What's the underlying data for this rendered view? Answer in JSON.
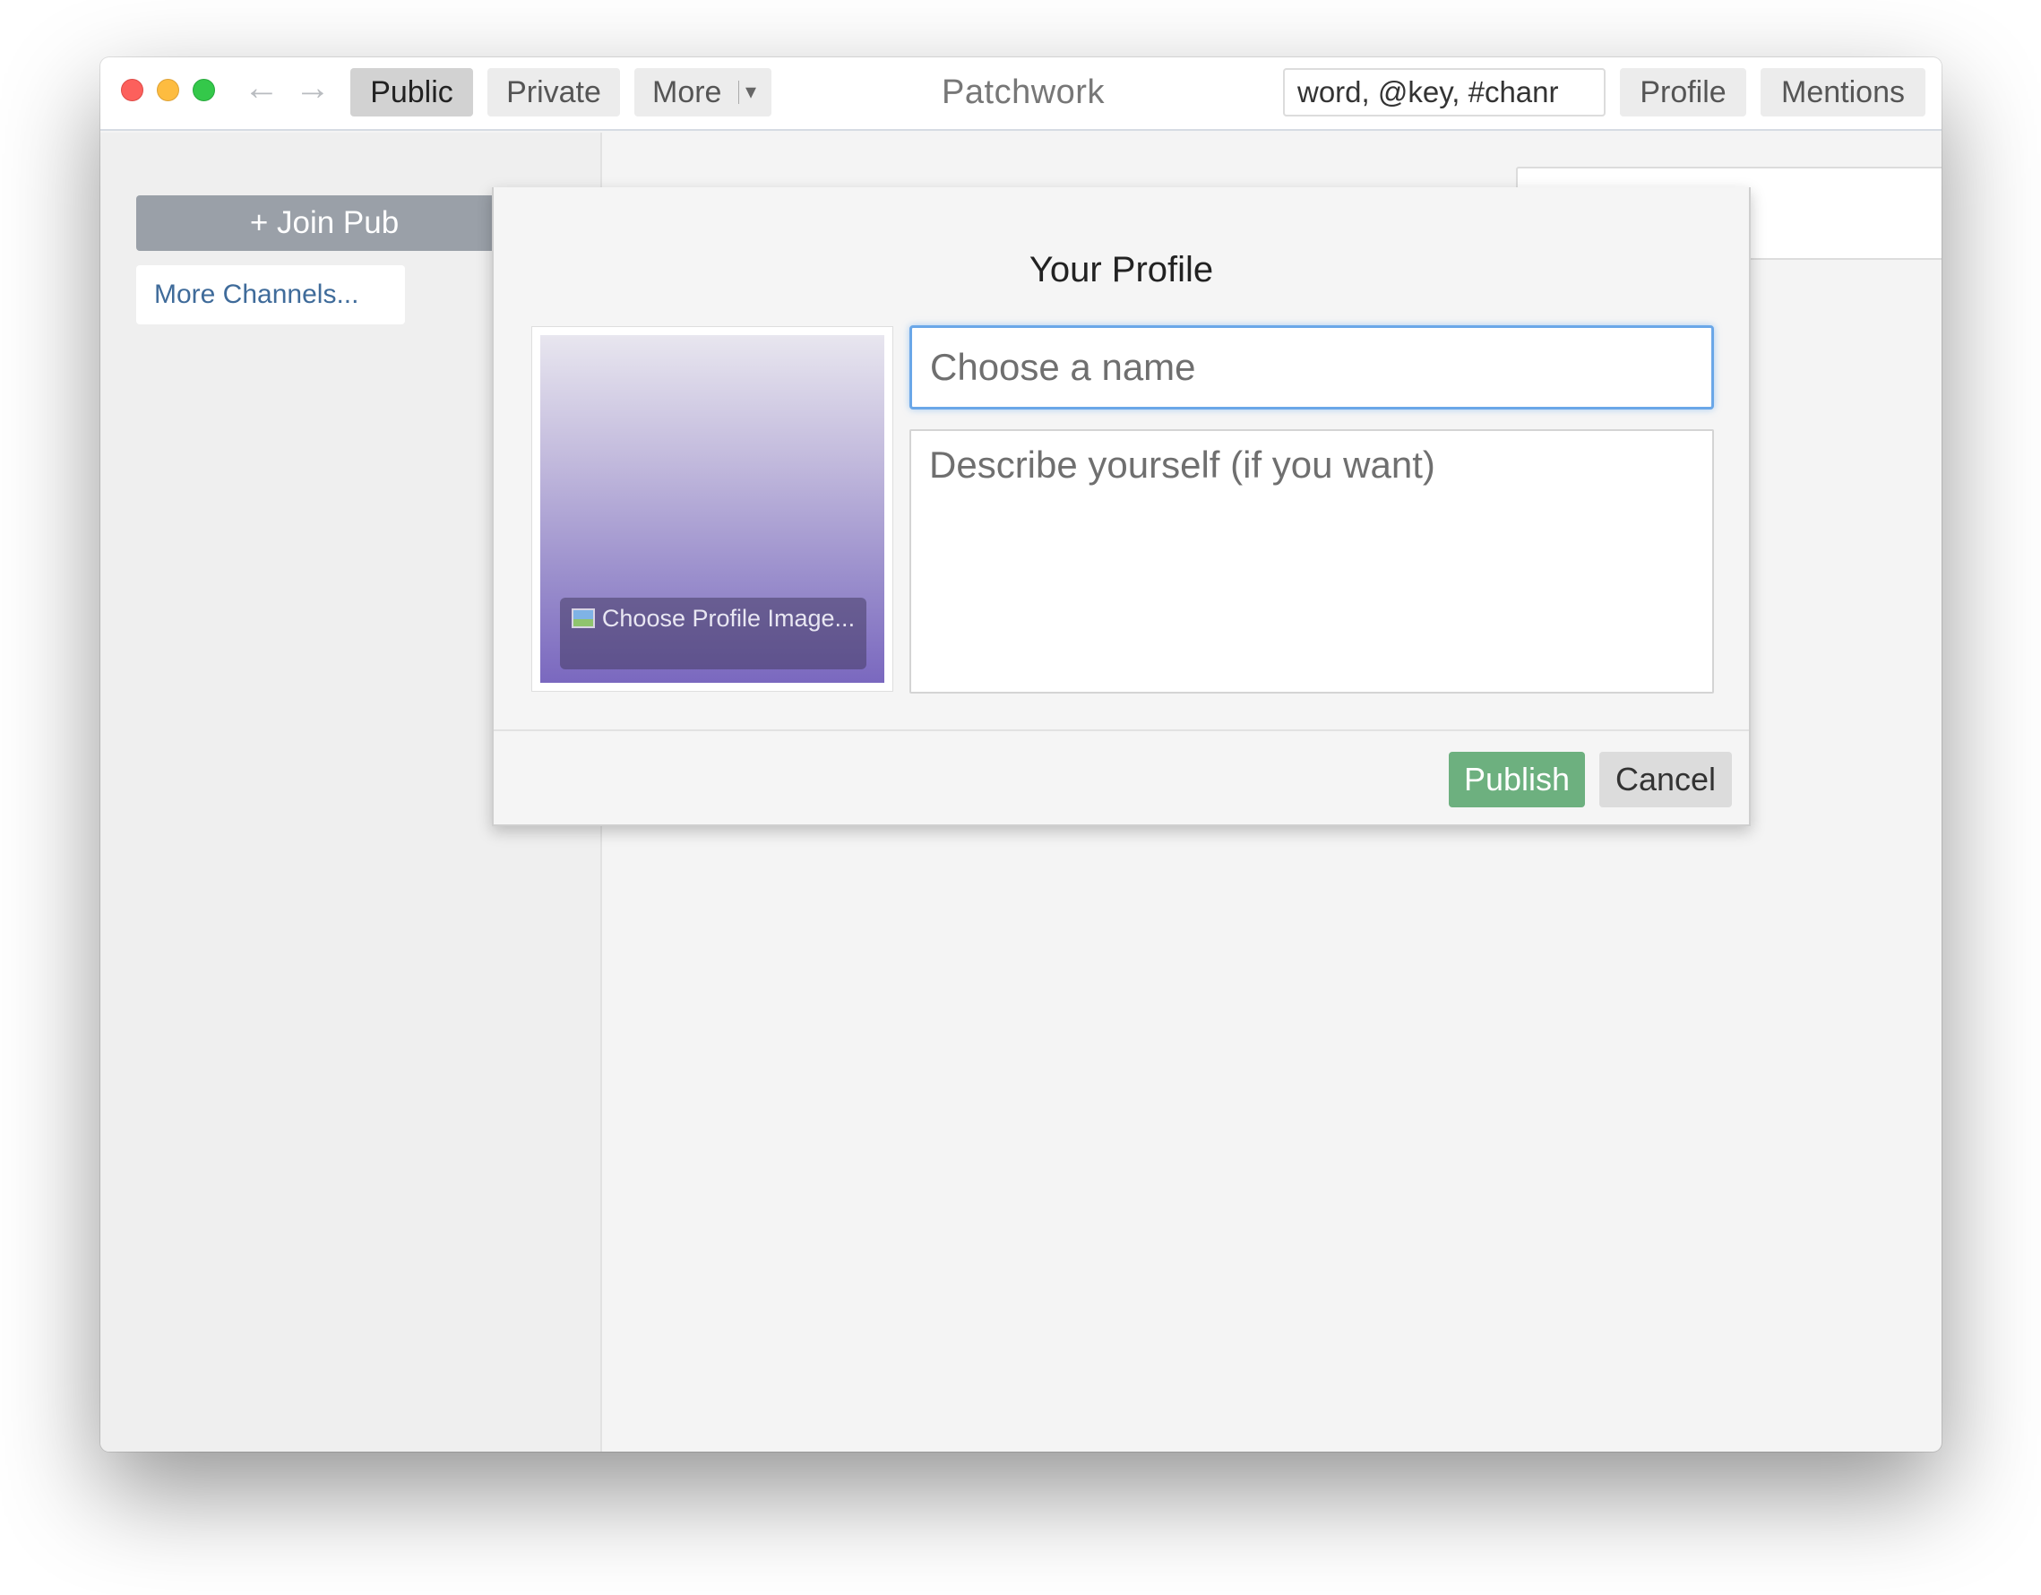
{
  "titlebar": {
    "app_title": "Patchwork",
    "back_icon": "←",
    "forward_icon": "→",
    "tabs": {
      "public": "Public",
      "private": "Private",
      "more": "More",
      "more_caret": "▾"
    },
    "search_value": "word, @key, #chanr",
    "profile": "Profile",
    "mentions": "Mentions"
  },
  "sidebar": {
    "join_button": "+ Join Pub",
    "more_channels": "More Channels..."
  },
  "modal": {
    "title": "Your Profile",
    "choose_image": "Choose Profile Image...",
    "name_placeholder": "Choose a name",
    "description_placeholder": "Describe yourself (if you want)",
    "publish": "Publish",
    "cancel": "Cancel"
  },
  "colors": {
    "publish": "#6db07f",
    "focus_ring": "#6aa7e8",
    "link": "#3f6b9a"
  }
}
